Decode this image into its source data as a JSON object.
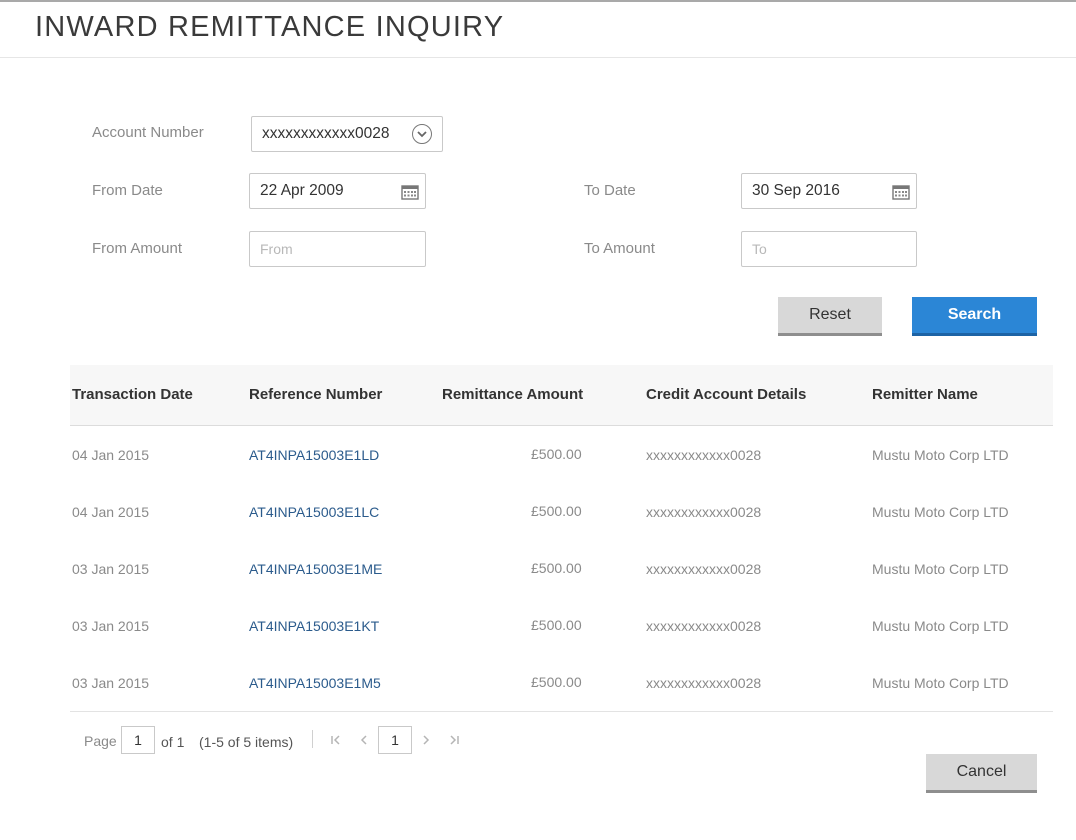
{
  "page": {
    "title": "INWARD REMITTANCE INQUIRY"
  },
  "form": {
    "account_number_label": "Account Number",
    "account_number_value": "xxxxxxxxxxxx0028",
    "from_date_label": "From Date",
    "from_date_value": "22 Apr 2009",
    "to_date_label": "To Date",
    "to_date_value": "30 Sep 2016",
    "from_amount_label": "From Amount",
    "from_amount_placeholder": "From",
    "to_amount_label": "To Amount",
    "to_amount_placeholder": "To",
    "reset_label": "Reset",
    "search_label": "Search"
  },
  "table": {
    "headers": [
      "Transaction Date",
      "Reference Number",
      "Remittance Amount",
      "Credit Account Details",
      "Remitter Name"
    ],
    "rows": [
      {
        "date": "04 Jan 2015",
        "ref": "AT4INPA15003E1LD",
        "amount": "£500.00",
        "account": "xxxxxxxxxxxx0028",
        "remitter": "Mustu Moto Corp LTD"
      },
      {
        "date": "04 Jan 2015",
        "ref": "AT4INPA15003E1LC",
        "amount": "£500.00",
        "account": "xxxxxxxxxxxx0028",
        "remitter": "Mustu Moto Corp LTD"
      },
      {
        "date": "03 Jan 2015",
        "ref": "AT4INPA15003E1ME",
        "amount": "£500.00",
        "account": "xxxxxxxxxxxx0028",
        "remitter": "Mustu Moto Corp LTD"
      },
      {
        "date": "03 Jan 2015",
        "ref": "AT4INPA15003E1KT",
        "amount": "£500.00",
        "account": "xxxxxxxxxxxx0028",
        "remitter": "Mustu Moto Corp LTD"
      },
      {
        "date": "03 Jan 2015",
        "ref": "AT4INPA15003E1M5",
        "amount": "£500.00",
        "account": "xxxxxxxxxxxx0028",
        "remitter": "Mustu Moto Corp LTD"
      }
    ]
  },
  "pager": {
    "page_label": "Page",
    "page_value": "1",
    "of_label": "of 1",
    "items_label": "(1-5 of 5 items)",
    "current_page": "1",
    "first_icon": "first-page-icon",
    "prev_icon": "prev-page-icon",
    "next_icon": "next-page-icon",
    "last_icon": "last-page-icon"
  },
  "footer": {
    "cancel_label": "Cancel"
  },
  "colors": {
    "primary": "#2b86d6",
    "link": "#2b5b8c",
    "secondary_button": "#d8d8d8"
  }
}
